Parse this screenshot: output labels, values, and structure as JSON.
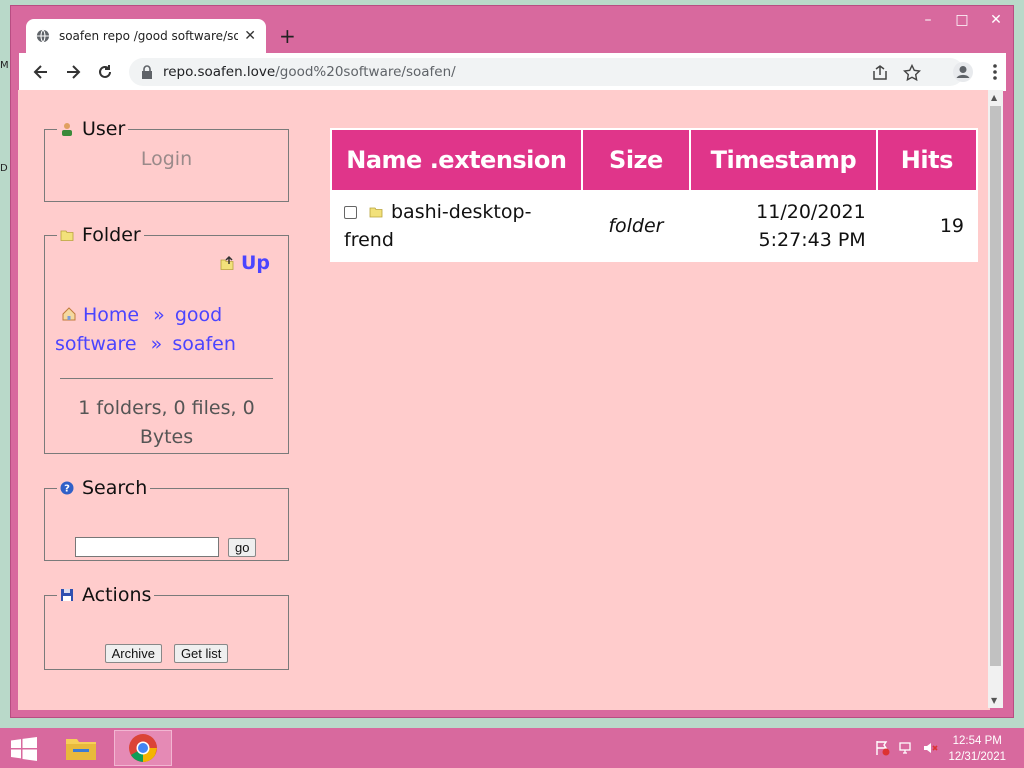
{
  "browser": {
    "tab_title": "soafen repo /good software/soafen/",
    "url_host": "repo.soafen.love",
    "url_path": "/good%20software/soafen/"
  },
  "sidebar": {
    "user": {
      "legend": "User",
      "login": "Login"
    },
    "folder": {
      "legend": "Folder",
      "up": "Up",
      "crumbs": [
        "Home",
        "»",
        "good software",
        "»",
        "soafen"
      ],
      "stats": "1 folders, 0 files, 0 Bytes"
    },
    "search": {
      "legend": "Search",
      "input_value": "",
      "go_label": "go"
    },
    "actions": {
      "legend": "Actions",
      "archive_label": "Archive",
      "getlist_label": "Get list"
    }
  },
  "table": {
    "headers": [
      "Name .extension",
      "Size",
      "Timestamp",
      "Hits"
    ],
    "rows": [
      {
        "name": "bashi-desktop-frend",
        "size": "folder",
        "date": "11/20/2021",
        "time": "5:27:43 PM",
        "hits": "19"
      }
    ]
  },
  "taskbar": {
    "time": "12:54 PM",
    "date": "12/31/2021"
  },
  "colors": {
    "accent": "#e0358a",
    "page_bg": "#ffcccc",
    "link": "#4b44ff",
    "window_frame": "#d8699e"
  },
  "icons": [
    "globe-icon",
    "close-icon",
    "plus-icon",
    "back-icon",
    "forward-icon",
    "reload-icon",
    "lock-icon",
    "share-icon",
    "star-icon",
    "profile-icon",
    "menu-icon",
    "user-icon",
    "folder-icon",
    "up-icon",
    "home-icon",
    "help-icon",
    "save-icon",
    "windows-start-icon",
    "file-explorer-icon",
    "chrome-icon"
  ]
}
